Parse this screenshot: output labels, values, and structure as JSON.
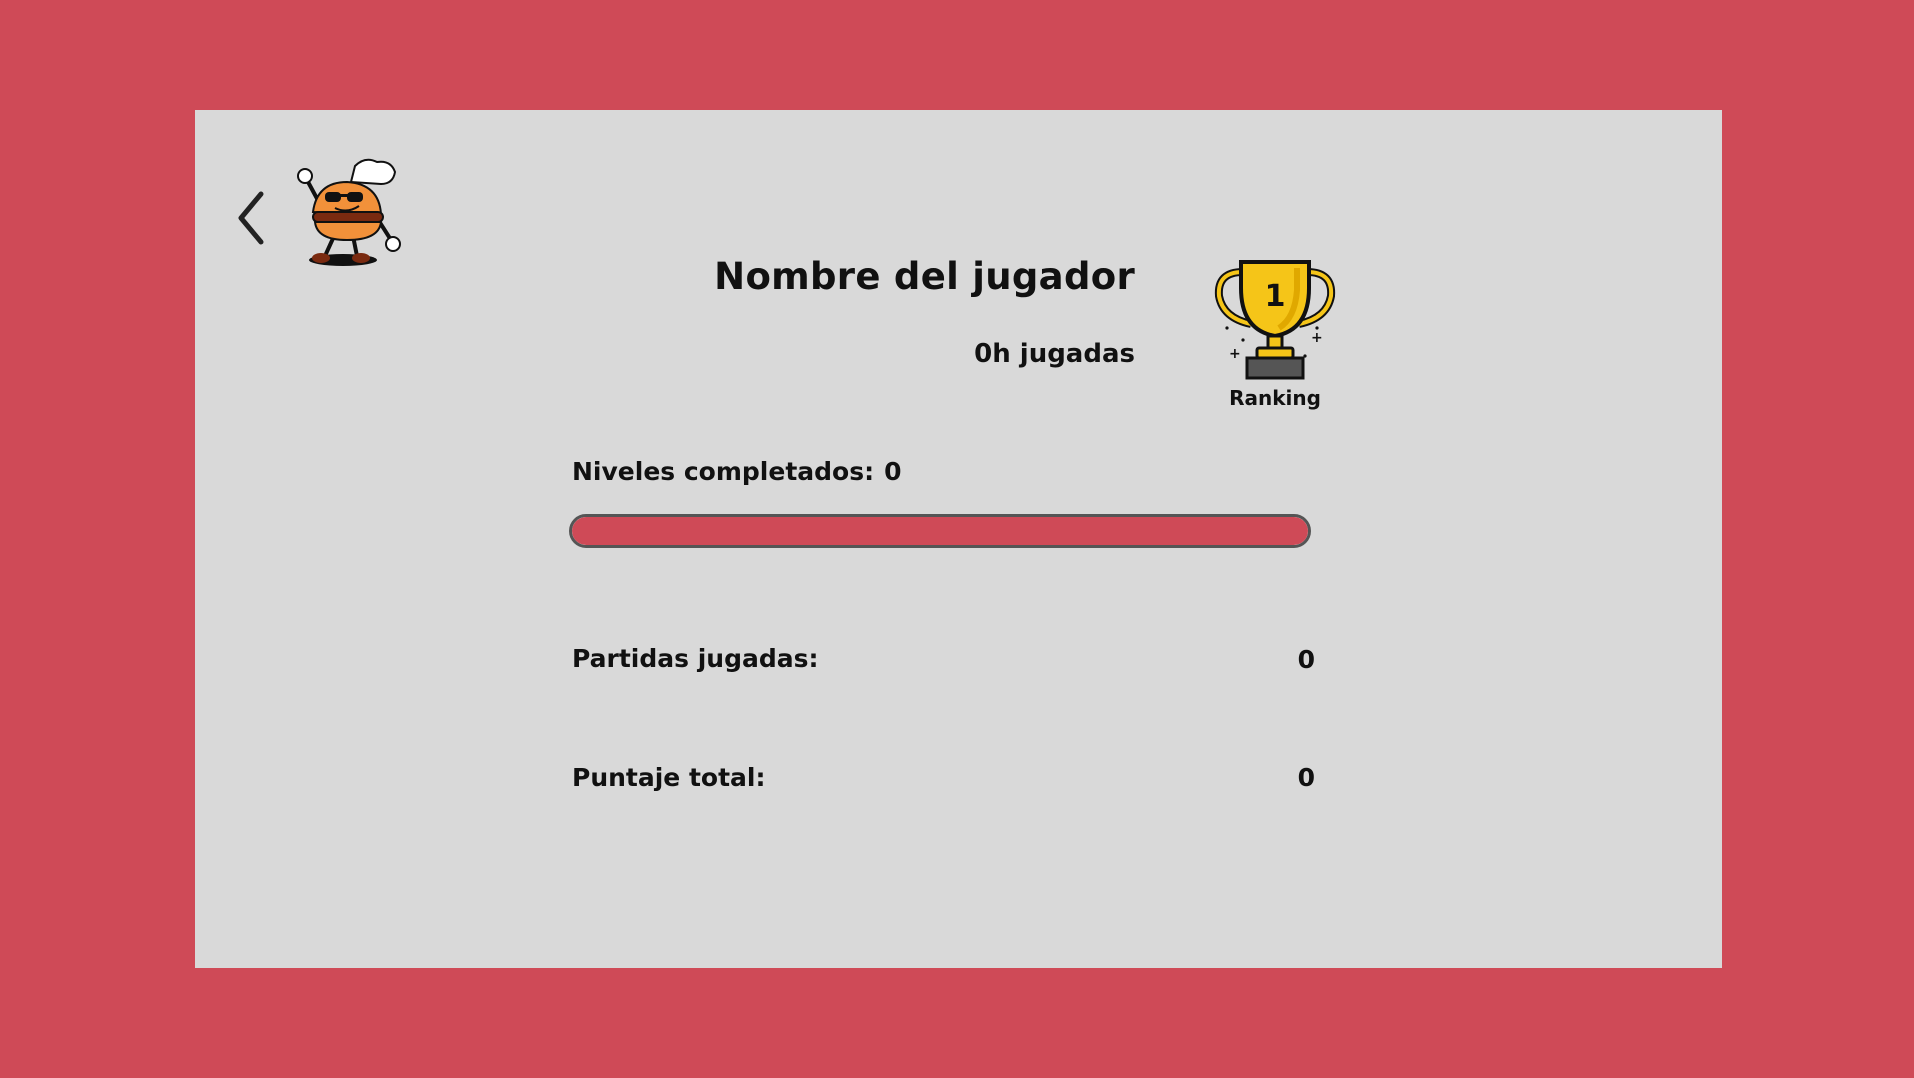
{
  "player": {
    "name": "Nombre del jugador",
    "hours": "0h jugadas"
  },
  "ranking": {
    "label": "Ranking",
    "trophy_number": "1",
    "icon": "trophy-icon"
  },
  "levels": {
    "label": "Niveles completados:",
    "value": "0",
    "progress": 1.0,
    "bar_color": "#cf4a57"
  },
  "stats": {
    "games_label": "Partidas jugadas:",
    "games_value": "0",
    "score_label": "Puntaje total:",
    "score_value": "0"
  },
  "colors": {
    "background": "#cf4a57",
    "panel": "#d9d9d9",
    "trophy_gold": "#f5c518"
  },
  "icons": {
    "back": "chevron-left-icon",
    "mascot": "burger-chef-mascot"
  }
}
